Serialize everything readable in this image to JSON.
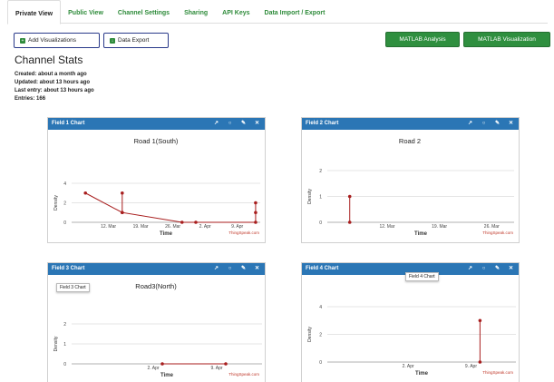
{
  "tabs": [
    "Private View",
    "Public View",
    "Channel Settings",
    "Sharing",
    "API Keys",
    "Data Import / Export"
  ],
  "buttons": {
    "add_visualizations": "Add Visualizations",
    "data_export": "Data Export",
    "matlab_analysis": "MATLAB Analysis",
    "matlab_visualization": "MATLAB Visualization"
  },
  "channel": {
    "title": "Channel Stats",
    "created_label": "Created:",
    "created": "about a month ago",
    "updated_label": "Updated:",
    "updated": "about 13 hours ago",
    "last_entry_label": "Last entry:",
    "last_entry": "about 13 hours ago",
    "entries_label": "Entries:",
    "entries": "166"
  },
  "header_icons": [
    "external-link-icon",
    "comment-icon",
    "pencil-icon",
    "close-icon"
  ],
  "colors": {
    "tab_green": "#2e8b3a",
    "panel_header": "#2b76b5",
    "button_green": "#2f8f3f",
    "series": "#a81e1e"
  },
  "tooltips": {
    "field3": "Field 3 Chart",
    "field4": "Field 4 Chart"
  },
  "chart_data": [
    {
      "panel_title": "Field 1 Chart",
      "type": "line",
      "title": "Road 1(South)",
      "xlabel": "Time",
      "ylabel": "Density",
      "credit": "ThingSpeak.com",
      "x_ticks": [
        "12. Mar",
        "19. Mar",
        "26. Mar",
        "2. Apr",
        "9. Apr"
      ],
      "y_ticks": [
        0,
        2,
        4
      ],
      "ylim": [
        0,
        4
      ],
      "x": [
        "2024-03-07",
        "2024-03-15",
        "2024-03-15",
        "2024-03-15",
        "2024-03-28",
        "2024-03-31",
        "2024-04-13",
        "2024-04-13",
        "2024-04-13"
      ],
      "y": [
        3,
        1,
        3,
        1,
        0,
        0,
        0,
        2,
        1
      ]
    },
    {
      "panel_title": "Field 2 Chart",
      "type": "line",
      "title": "Road 2",
      "xlabel": "Time",
      "ylabel": "Density",
      "credit": "ThingSpeak.com",
      "x_ticks": [
        "12. Mar",
        "19. Mar",
        "26. Mar"
      ],
      "y_ticks": [
        0,
        1,
        2
      ],
      "ylim": [
        0,
        2
      ],
      "x": [
        "2024-03-07",
        "2024-03-07"
      ],
      "y": [
        0,
        1
      ]
    },
    {
      "panel_title": "Field 3 Chart",
      "type": "line",
      "title": "Road3(North)",
      "xlabel": "Time",
      "ylabel": "Density",
      "credit": "ThingSpeak.com",
      "x_ticks": [
        "2. Apr",
        "9. Apr"
      ],
      "y_ticks": [
        0,
        1,
        2
      ],
      "ylim": [
        0,
        2
      ],
      "x": [
        "2024-04-03",
        "2024-04-10"
      ],
      "y": [
        0,
        0
      ]
    },
    {
      "panel_title": "Field 4 Chart",
      "type": "line",
      "title": "",
      "xlabel": "Time",
      "ylabel": "Density",
      "credit": "ThingSpeak.com",
      "x_ticks": [
        "2. Apr",
        "9. Apr"
      ],
      "y_ticks": [
        0,
        2,
        4
      ],
      "ylim": [
        0,
        4
      ],
      "x": [
        "2024-04-10",
        "2024-04-10"
      ],
      "y": [
        0,
        3
      ]
    }
  ]
}
